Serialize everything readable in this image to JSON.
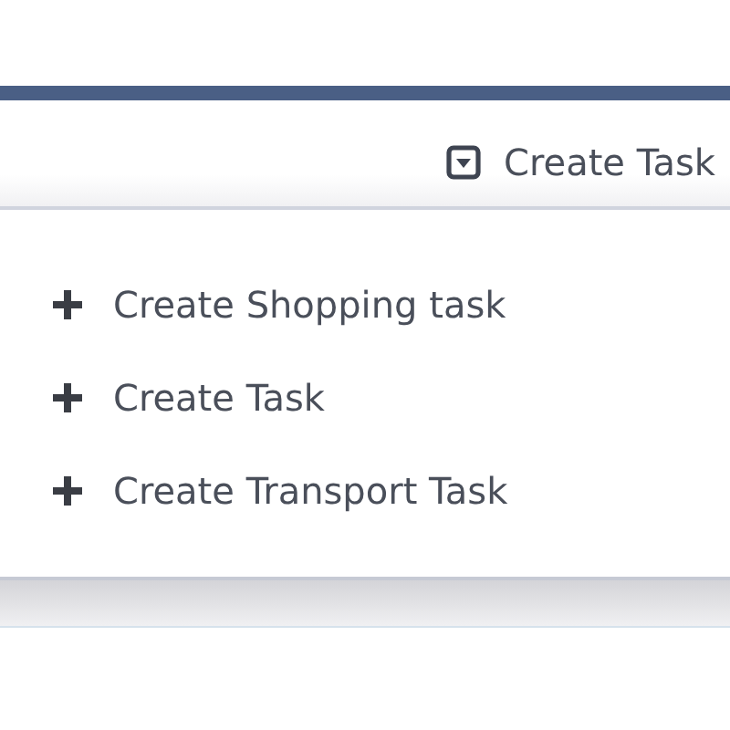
{
  "header": {
    "button": {
      "label": "Create Task"
    }
  },
  "menu": {
    "items": [
      {
        "label": "Create Shopping task"
      },
      {
        "label": "Create Task"
      },
      {
        "label": "Create Transport Task"
      }
    ]
  }
}
